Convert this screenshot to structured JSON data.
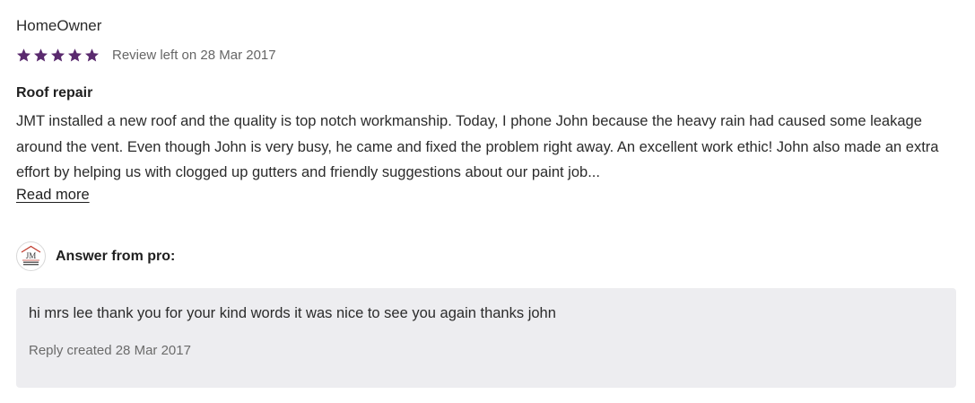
{
  "review": {
    "reviewer_name": "HomeOwner",
    "rating": 5,
    "rating_max": 5,
    "star_color": "#5a2a6e",
    "date_text": "Review left on 28 Mar 2017",
    "title": "Roof repair",
    "body": "JMT installed a new roof and the quality is top notch workmanship. Today, I phone John because the heavy rain had caused some leakage around the vent. Even though John is very busy, he came and fixed the problem right away. An excellent work ethic! John also made an extra effort by helping us with clogged up gutters and friendly suggestions about our paint job...",
    "read_more_label": "Read more"
  },
  "answer": {
    "avatar_icon": "jm-roofing-painting-logo",
    "avatar_logo_text": "JM",
    "avatar_logo_subtext": "Roofing Painting",
    "label": "Answer from pro:",
    "reply_text": "hi mrs lee thank you for your kind words it was nice to see you again thanks john",
    "reply_date_text": "Reply created 28 Mar 2017",
    "reply_bg_color": "#ededf0"
  }
}
